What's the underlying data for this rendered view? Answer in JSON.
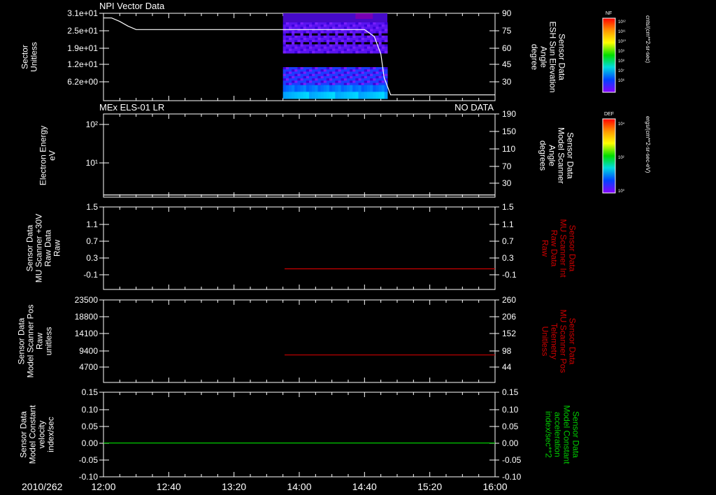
{
  "date_label": "2010/262",
  "x_ticks": [
    "12:00",
    "12:40",
    "13:20",
    "14:00",
    "14:40",
    "15:20",
    "16:00"
  ],
  "x_range_minutes": [
    0,
    240
  ],
  "colors": {
    "white": "#ffffff",
    "red": "#cc0000",
    "green": "#00cc00",
    "background": "#000000"
  },
  "colorbars": [
    {
      "title": "NF",
      "unit": "cnts/(cm**2-sr-sec)",
      "ticks": [
        "10¹²",
        "10¹¹",
        "10¹⁰",
        "10⁹",
        "10⁸",
        "10⁷",
        "10⁶"
      ]
    },
    {
      "title": "DEF",
      "unit": "ergs/(cm**2-sr-sec-eV)",
      "ticks": [
        "10⁴",
        "10²",
        "10⁰"
      ]
    }
  ],
  "chart_data": [
    {
      "type": "heatmap",
      "title": "NPI Vector Data",
      "ylabel_left": [
        "Sector",
        "Unitless"
      ],
      "left_ticks": [
        "3.1e+01",
        "2.5e+01",
        "1.9e+01",
        "1.2e+01",
        "6.2e+00"
      ],
      "ylabel_right": [
        "Sensor Data",
        "ESH Sun Elevation",
        "Angle",
        "degree"
      ],
      "right_ticks": [
        "90",
        "75",
        "60",
        "45",
        "30"
      ],
      "right_ylim": [
        15,
        90
      ],
      "heatmap_time_range_minutes": [
        110,
        174
      ],
      "series": [
        {
          "axis": "right",
          "color": "#ffffff",
          "x": [
            0,
            5,
            10,
            15,
            20,
            25,
            60,
            100,
            140,
            160,
            166,
            170,
            172,
            176,
            240
          ],
          "y": [
            86,
            86,
            83,
            79,
            76,
            76,
            76,
            76,
            76,
            76,
            70,
            55,
            35,
            20,
            20
          ]
        }
      ]
    },
    {
      "type": "line",
      "title": "MEx ELS-01 LR",
      "status": "NO DATA",
      "ylabel_left": [
        "Electron Energy",
        "eV"
      ],
      "left_ticks": [
        "10²",
        "10¹"
      ],
      "ylabel_right": [
        "Sensor Data",
        "Model Scanner",
        "Angle",
        "degrees"
      ],
      "right_ticks": [
        "190",
        "150",
        "110",
        "70",
        "30"
      ],
      "right_ylim": [
        0,
        190
      ],
      "series": [
        {
          "axis": "right",
          "color": "#ffffff",
          "x": [
            0,
            240
          ],
          "y": [
            5,
            5
          ]
        }
      ]
    },
    {
      "type": "line",
      "ylabel_left": [
        "Sensor Data",
        "MU Scanner +30V",
        "Raw Data",
        "Raw"
      ],
      "left_ticks": [
        "1.5",
        "1.1",
        "0.7",
        "0.3",
        "-0.1"
      ],
      "left_ylim": [
        -0.5,
        1.5
      ],
      "ylabel_right": [
        "Sensor Data",
        "MU Scanner Int",
        "Raw Data",
        "Raw"
      ],
      "right_ticks": [
        "1.5",
        "1.1",
        "0.7",
        "0.3",
        "-0.1"
      ],
      "right_ylim": [
        -0.5,
        1.5
      ],
      "series": [
        {
          "axis": "right",
          "color": "#cc0000",
          "x": [
            111,
            240
          ],
          "y": [
            0,
            0
          ]
        }
      ]
    },
    {
      "type": "line",
      "ylabel_left": [
        "Sensor Data",
        "Model Scanner Pos",
        "Raw",
        "unitless"
      ],
      "left_ticks": [
        "23500",
        "18800",
        "14100",
        "9400",
        "4700"
      ],
      "left_ylim": [
        0,
        23500
      ],
      "ylabel_right": [
        "Sensor Data",
        "MU Scanner Pos",
        "Telemetry",
        "Unitless"
      ],
      "right_ticks": [
        "260",
        "206",
        "152",
        "98",
        "44"
      ],
      "right_ylim": [
        -10,
        260
      ],
      "series": [
        {
          "axis": "right",
          "color": "#cc0000",
          "x": [
            111,
            240
          ],
          "y": [
            80,
            80
          ]
        }
      ]
    },
    {
      "type": "line",
      "ylabel_left": [
        "Sensor Data",
        "Model Constant",
        "velocity",
        "index/sec"
      ],
      "left_ticks": [
        "0.15",
        "0.10",
        "0.05",
        "0.00",
        "-0.05",
        "-0.10"
      ],
      "left_ylim": [
        -0.1,
        0.15
      ],
      "ylabel_right": [
        "Sensor Data",
        "Model Constant",
        "acceleration",
        "index/sec**2"
      ],
      "right_ticks": [
        "0.15",
        "0.10",
        "0.05",
        "0.00",
        "-0.05",
        "-0.10"
      ],
      "right_ylim": [
        -0.1,
        0.15
      ],
      "series": [
        {
          "axis": "left",
          "color": "#00cc00",
          "x": [
            0,
            240
          ],
          "y": [
            0,
            0
          ]
        }
      ]
    }
  ]
}
